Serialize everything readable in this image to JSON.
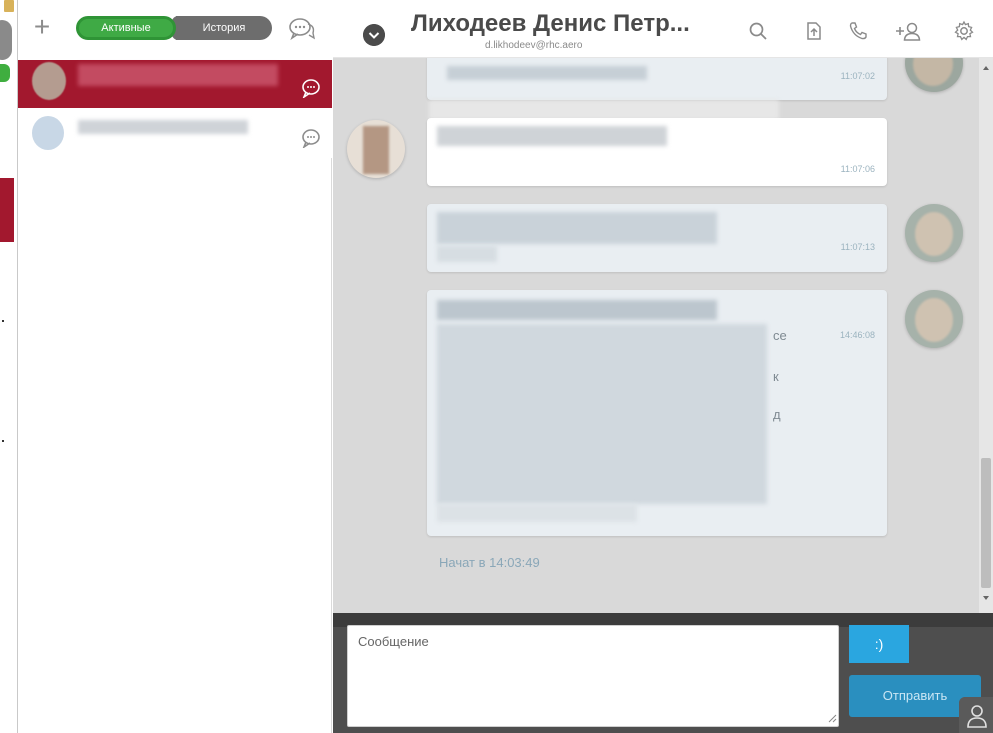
{
  "left_panel": {
    "add_label": "+",
    "tab_active": "Активные",
    "tab_history": "История"
  },
  "chat": {
    "title": "Лиходеев Денис Петр...",
    "email": "d.likhodeev@rhc.aero"
  },
  "messages": [
    {
      "direction": "out",
      "time": "11:07:02"
    },
    {
      "direction": "in",
      "time": "11:07:06"
    },
    {
      "direction": "out",
      "time": "11:07:13"
    },
    {
      "direction": "out",
      "time": "14:46:08"
    }
  ],
  "fragments": [
    "ce",
    "к",
    "д"
  ],
  "started_text": "Начат в 14:03:49",
  "composer": {
    "placeholder": "Сообщение",
    "emoji_label": ":)",
    "send_label": "Отправить"
  },
  "colors": {
    "accent_red": "#a2182e",
    "active_green": "#3faa45",
    "send_blue": "#2a8fbf"
  },
  "icons": [
    "chat-bubbles-icon",
    "search-icon",
    "file-upload-icon",
    "phone-icon",
    "add-user-icon",
    "gear-icon",
    "user-icon"
  ]
}
